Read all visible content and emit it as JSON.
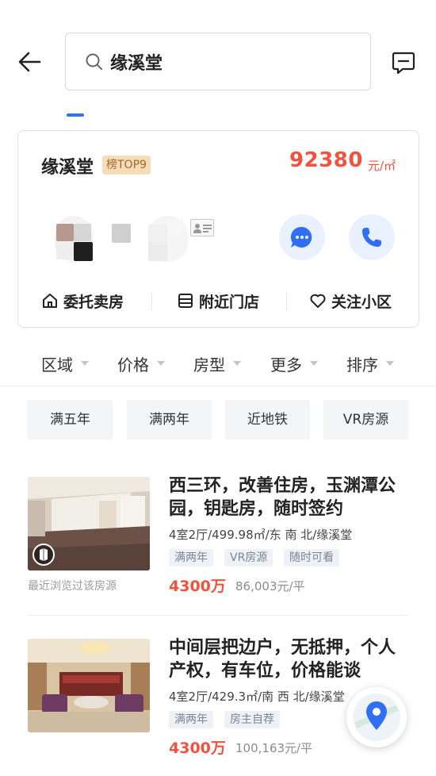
{
  "header": {
    "search_query": "缘溪堂"
  },
  "community": {
    "name": "缘溪堂",
    "rank_badge": "榜TOP9",
    "price": "92380",
    "price_unit": "元/㎡",
    "actions": [
      {
        "label": "委托卖房",
        "icon": "home-icon"
      },
      {
        "label": "附近门店",
        "icon": "store-icon"
      },
      {
        "label": "关注小区",
        "icon": "heart-icon"
      }
    ]
  },
  "filters": [
    "区域",
    "价格",
    "房型",
    "更多",
    "排序"
  ],
  "quick_tags": [
    "满五年",
    "满两年",
    "近地铁",
    "VR房源"
  ],
  "listings": [
    {
      "title": "西三环，改善住房，玉渊潭公园，钥匙房，随时签约",
      "info": "4室2厅/499.98㎡/东 南 北/缘溪堂",
      "tags": [
        "满两年",
        "VR房源",
        "随时可看"
      ],
      "price": "4300万",
      "unit_price": "86,003元/平",
      "note": "最近浏览过该房源",
      "has_vr": true
    },
    {
      "title": "中间层把边户，无抵押，个人产权，有车位，价格能谈",
      "info": "4室2厅/429.3㎡/南 西 北/缘溪堂",
      "tags": [
        "满两年",
        "房主自荐"
      ],
      "price": "4300万",
      "unit_price": "100,163元/平",
      "note": "",
      "has_vr": false
    }
  ],
  "colors": {
    "accent": "#3072f6",
    "price": "#f2523d",
    "badge_bg": "#f6dcb7"
  }
}
